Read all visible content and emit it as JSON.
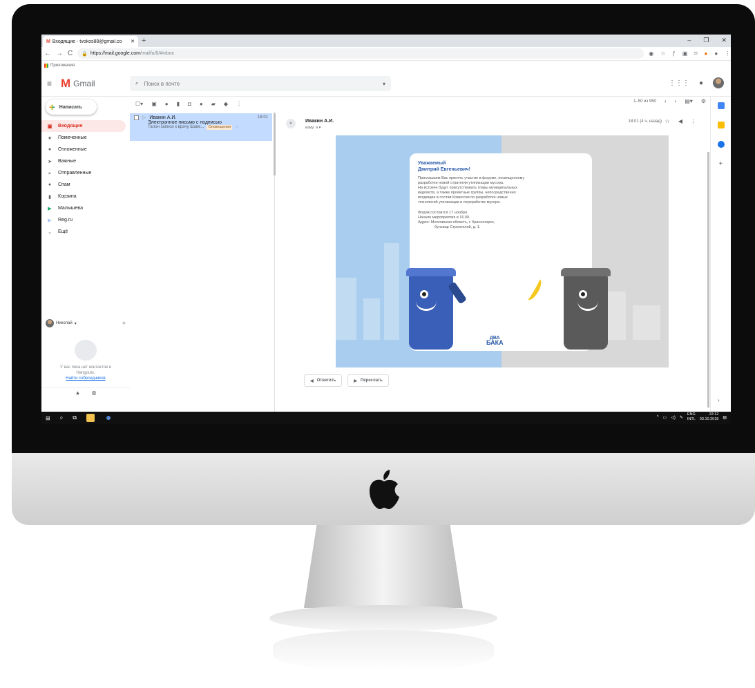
{
  "browser": {
    "tab_title": "Входящие - tvokos88@gmail.co",
    "new_tab": "+",
    "url_host": "https://mail.google.com",
    "url_path": "/mail/u/0/#inbox",
    "bookmark_apps": "Приложения"
  },
  "gmail": {
    "logo_text": "Gmail",
    "search_placeholder": "Поиск в почте",
    "compose_label": "Написать",
    "folders": [
      {
        "label": "Входящие",
        "icon": "inbox-icon",
        "active": true
      },
      {
        "label": "Помеченные",
        "icon": "star-icon"
      },
      {
        "label": "Отложенные",
        "icon": "clock-icon"
      },
      {
        "label": "Важные",
        "icon": "important-icon"
      },
      {
        "label": "Отправленные",
        "icon": "send-icon"
      },
      {
        "label": "Спам",
        "icon": "spam-icon"
      },
      {
        "label": "Корзина",
        "icon": "trash-icon"
      },
      {
        "label": "Малышева",
        "icon": "label-icon"
      },
      {
        "label": "Reg.ru",
        "icon": "label-icon"
      },
      {
        "label": "Ещё",
        "icon": "chevron-down-icon"
      }
    ],
    "hangouts": {
      "user": "Николай",
      "empty_text_1": "У вас пока нет контактов в",
      "empty_text_2": "Hangouts.",
      "find_link": "Найти собеседников"
    },
    "pager": "1–50 из 950",
    "email_row": {
      "sender": "Ивакин А.И.",
      "time": "18:01",
      "subject": "Электронное письмо с подписью",
      "snippet": "Талон записи к врачу Шаве...",
      "label": "Оповещения"
    },
    "message": {
      "sender": "Ивакин А.И.",
      "to": "кому: я",
      "time": "18:01 (4 ч. назад)",
      "reply_label": "Ответить",
      "forward_label": "Переслать"
    },
    "banner": {
      "greeting_1": "Уважаемый",
      "greeting_2": "Дмитрий Евгеньевич!",
      "p1_l1": "Приглашаем Вас принять участие в форуме, посвященному",
      "p1_l2": "разработке новой стратегии утилизации мусора.",
      "p2_l1": "На встрече будут присутствовать главы муниципальных",
      "p2_l2": "ведомств, а также проектные группы, непосредственно",
      "p2_l3": "входящие в состав Комиссии по разработке новых",
      "p2_l4": "технологий утилизации и переработке мусора.",
      "p3_l1": "Форум состоится 17 ноября.",
      "p3_l2": "Начало мероприятия в 16.00.",
      "p3_l3": "Адрес: Московская область, г. Красногорск,",
      "p3_l4": "бульвар Строителей, д. 1.",
      "logo_1": "ДВА",
      "logo_2": "БАКА"
    }
  },
  "taskbar": {
    "lang_1": "ENG",
    "lang_2": "INTL",
    "time": "22:12",
    "date": "03.10.2018"
  },
  "colors": {
    "gmail_red": "#ea4335",
    "selected_row": "#c2dbff",
    "banner_blue": "#a9cdee",
    "banner_gray": "#d8d8d8",
    "bin_blue": "#3a5fb8",
    "bin_gray": "#5a5a5a"
  }
}
